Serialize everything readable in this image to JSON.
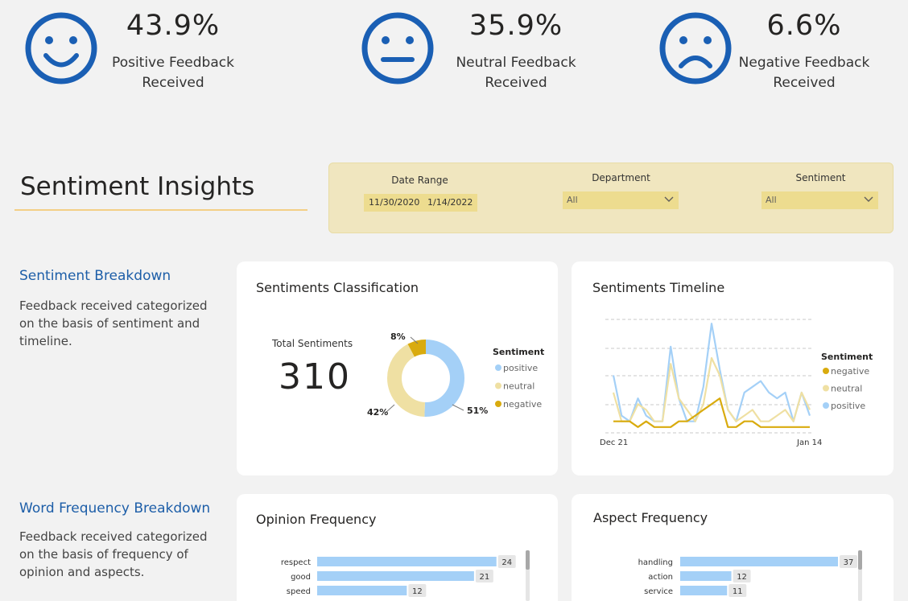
{
  "kpis": {
    "positive": {
      "pct": "43.9%",
      "label1": "Positive Feedback",
      "label2": "Received",
      "icon": "smiley-happy-icon"
    },
    "neutral": {
      "pct": "35.9%",
      "label1": "Neutral Feedback",
      "label2": "Received",
      "icon": "smiley-neutral-icon"
    },
    "negative": {
      "pct": "6.6%",
      "label1": "Negative Feedback",
      "label2": "Received",
      "icon": "smiley-sad-icon"
    }
  },
  "section_title": "Sentiment Insights",
  "filters": {
    "date_range_label": "Date Range",
    "date_start": "11/30/2020",
    "date_end": "1/14/2022",
    "department_label": "Department",
    "department_value": "All",
    "sentiment_label": "Sentiment",
    "sentiment_value": "All"
  },
  "breakdown": {
    "title": "Sentiment Breakdown",
    "desc": "Feedback received categorized on the basis of sentiment and timeline."
  },
  "word_freq": {
    "title": "Word Frequency Breakdown",
    "desc": "Feedback received categorized on the basis of frequency of opinion and aspects."
  },
  "colors": {
    "positive": "#a4d0f7",
    "neutral": "#efe0a3",
    "negative": "#d9ab0e",
    "accent": "#1d5ea8",
    "bar": "#a4d0f7"
  },
  "classification": {
    "title": "Sentiments Classification",
    "total_label": "Total Sentiments",
    "total_value": "310"
  },
  "timeline": {
    "title": "Sentiments Timeline"
  },
  "opinion": {
    "title": "Opinion Frequency"
  },
  "aspect": {
    "title": "Aspect Frequency"
  },
  "chart_data": [
    {
      "type": "pie",
      "title": "Sentiments Classification",
      "legend_title": "Sentiment",
      "legend_position": "right",
      "categories": [
        "positive",
        "neutral",
        "negative"
      ],
      "values": [
        51,
        42,
        8
      ],
      "labels": [
        "51%",
        "42%",
        "8%"
      ]
    },
    {
      "type": "line",
      "title": "Sentiments Timeline",
      "legend_title": "Sentiment",
      "legend_position": "right",
      "x_ticks": [
        "Dec 21",
        "Jan 14"
      ],
      "grid": true,
      "ylim": [
        0,
        10
      ],
      "series": [
        {
          "name": "negative",
          "values": [
            1,
            1,
            1,
            0.5,
            1,
            0.5,
            0.5,
            0.5,
            1,
            1,
            1.5,
            2,
            2.5,
            3,
            0.5,
            0.5,
            1,
            1,
            0.5,
            0.5,
            0.5,
            0.5,
            0.5,
            0.5,
            0.5
          ]
        },
        {
          "name": "neutral",
          "values": [
            3.5,
            1,
            1,
            2.5,
            2,
            1,
            1,
            6,
            3,
            2,
            1,
            2.5,
            6.5,
            5,
            2,
            1,
            1.5,
            2,
            1,
            1,
            1.5,
            2,
            1,
            3.5,
            2
          ]
        },
        {
          "name": "positive",
          "values": [
            5,
            1.5,
            1,
            3,
            1.5,
            1,
            1,
            7.5,
            3,
            1,
            1,
            4,
            9.5,
            5.5,
            2,
            1,
            3.5,
            4,
            4.5,
            3.5,
            3,
            3.5,
            1,
            3.5,
            1.5
          ]
        }
      ]
    },
    {
      "type": "bar",
      "orientation": "horizontal",
      "title": "Opinion Frequency",
      "categories": [
        "respect",
        "good",
        "speed"
      ],
      "values": [
        24,
        21,
        12
      ],
      "xlim": [
        0,
        25
      ]
    },
    {
      "type": "bar",
      "orientation": "horizontal",
      "title": "Aspect Frequency",
      "categories": [
        "handling",
        "action",
        "service"
      ],
      "values": [
        37,
        12,
        11
      ],
      "xlim": [
        0,
        37
      ]
    }
  ]
}
